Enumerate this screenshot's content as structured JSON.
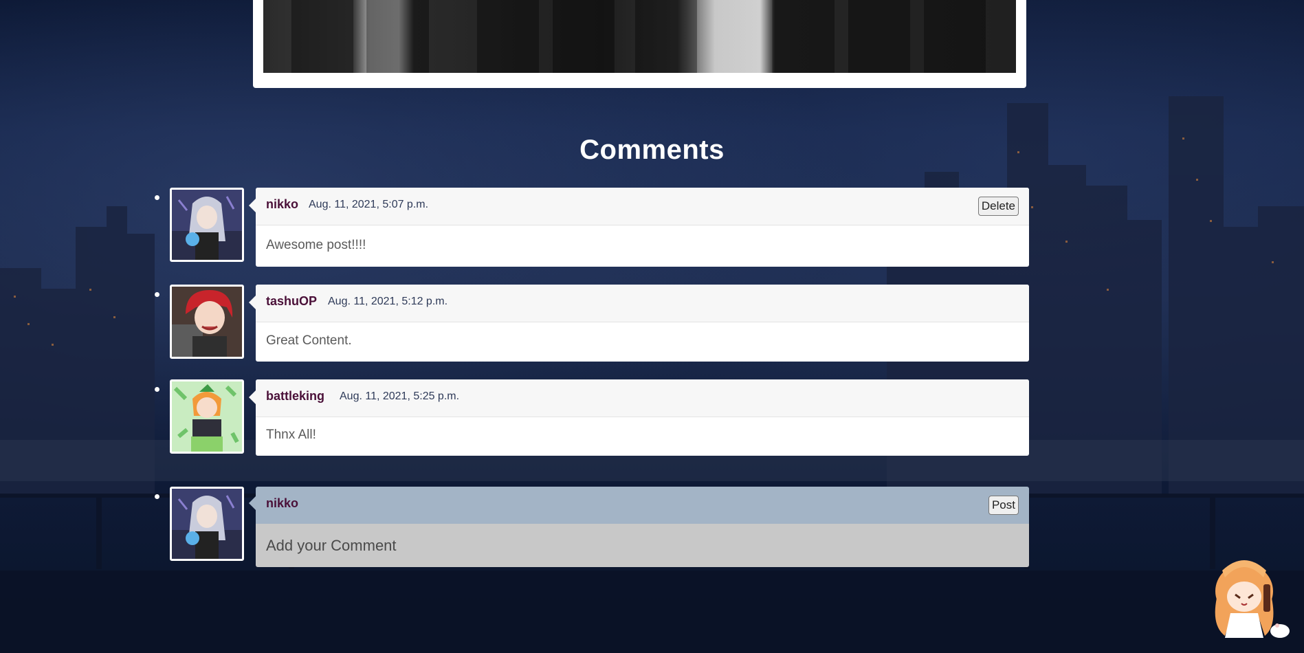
{
  "section": {
    "title": "Comments"
  },
  "comments": [
    {
      "user": "nikko",
      "timestamp": "Aug. 11, 2021, 5:07 p.m.",
      "text": "Awesome post!!!!",
      "action_label": "Delete"
    },
    {
      "user": "tashuOP",
      "timestamp": "Aug. 11, 2021, 5:12 p.m.",
      "text": "Great Content."
    },
    {
      "user": "battleking",
      "timestamp": "Aug. 11, 2021, 5:25 p.m.",
      "text": "Thnx All!"
    }
  ],
  "comment_form": {
    "user": "nikko",
    "placeholder": "Add your Comment",
    "submit_label": "Post"
  },
  "colors": {
    "username": "#4a1038",
    "timestamp": "#2e3a58",
    "form_header": "#a3b4c6",
    "form_body": "#c8c8c8"
  }
}
